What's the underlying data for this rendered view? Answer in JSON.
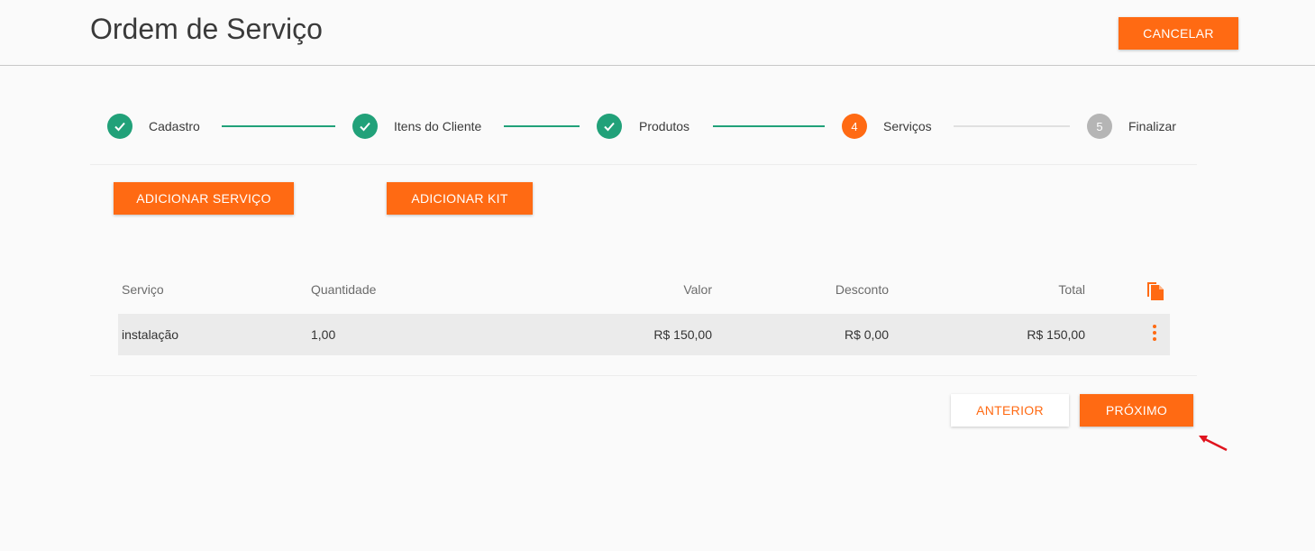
{
  "header": {
    "title": "Ordem de Serviço",
    "cancel_label": "CANCELAR"
  },
  "stepper": {
    "steps": [
      {
        "number": "1",
        "label": "Cadastro",
        "state": "done"
      },
      {
        "number": "2",
        "label": "Itens do Cliente",
        "state": "done"
      },
      {
        "number": "3",
        "label": "Produtos",
        "state": "done"
      },
      {
        "number": "4",
        "label": "Serviços",
        "state": "active"
      },
      {
        "number": "5",
        "label": "Finalizar",
        "state": "pending"
      }
    ]
  },
  "actions": {
    "add_service_label": "ADICIONAR SERVIÇO",
    "add_kit_label": "ADICIONAR KIT"
  },
  "table": {
    "headers": [
      "Serviço",
      "Quantidade",
      "Valor",
      "Desconto",
      "Total"
    ],
    "rows": [
      {
        "servico": "instalação",
        "quantidade": "1,00",
        "valor": "R$ 150,00",
        "desconto": "R$ 0,00",
        "total": "R$ 150,00"
      }
    ],
    "header_icon": "copy-icon",
    "row_icon": "more-vert-icon"
  },
  "footer": {
    "previous_label": "ANTERIOR",
    "next_label": "PRÓXIMO"
  },
  "colors": {
    "accent": "#ff6a13",
    "done": "#21a179",
    "pending": "#b5b5b5",
    "annotation_arrow": "#e0141e"
  }
}
